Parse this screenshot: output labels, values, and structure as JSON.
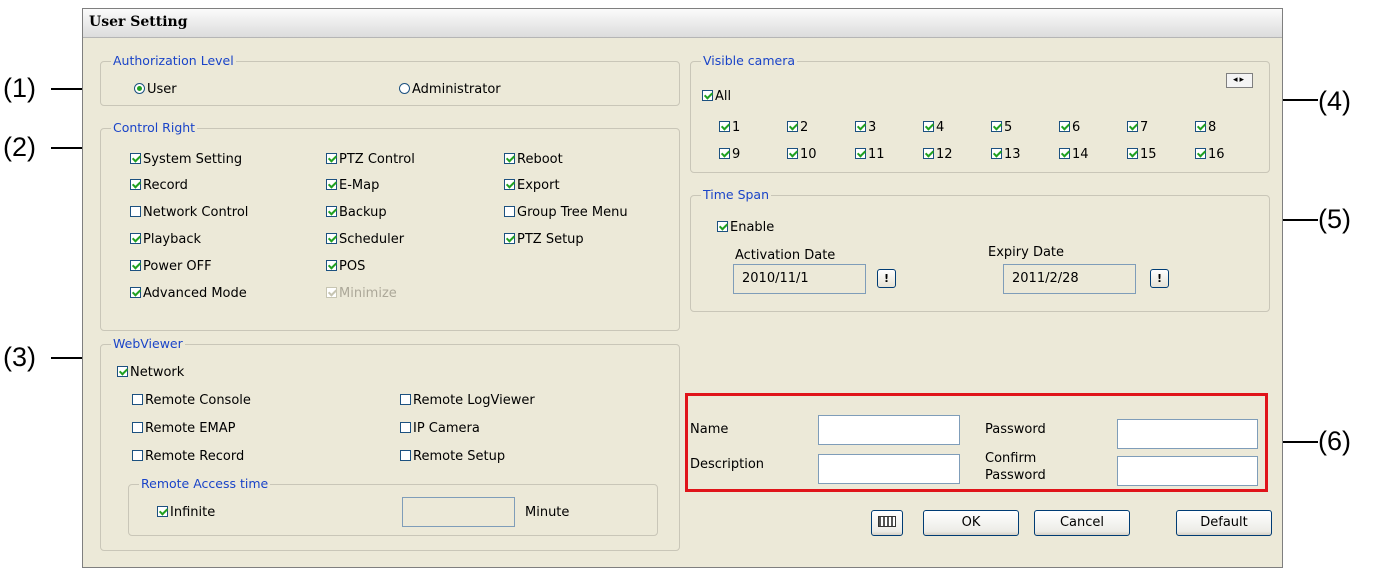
{
  "window": {
    "title": "User Setting"
  },
  "callouts": [
    "(1)",
    "(2)",
    "(3)",
    "(4)",
    "(5)",
    "(6)"
  ],
  "authorization": {
    "legend": "Authorization Level",
    "options": [
      {
        "label": "User",
        "selected": true
      },
      {
        "label": "Administrator",
        "selected": false
      }
    ]
  },
  "control_right": {
    "legend": "Control Right",
    "items": [
      {
        "label": "System Setting",
        "checked": true
      },
      {
        "label": "PTZ Control",
        "checked": true
      },
      {
        "label": "Reboot",
        "checked": true
      },
      {
        "label": "Record",
        "checked": true
      },
      {
        "label": "E-Map",
        "checked": true
      },
      {
        "label": "Export",
        "checked": true
      },
      {
        "label": "Network Control",
        "checked": false
      },
      {
        "label": "Backup",
        "checked": true
      },
      {
        "label": "Group Tree Menu",
        "checked": false
      },
      {
        "label": "Playback",
        "checked": true
      },
      {
        "label": "Scheduler",
        "checked": true
      },
      {
        "label": "PTZ Setup",
        "checked": true
      },
      {
        "label": "Power OFF",
        "checked": true
      },
      {
        "label": "POS",
        "checked": true
      },
      {
        "label": "Advanced Mode",
        "checked": true
      },
      {
        "label": "Minimize",
        "checked": true,
        "disabled": true
      }
    ]
  },
  "webviewer": {
    "legend": "WebViewer",
    "network": {
      "label": "Network",
      "checked": true
    },
    "items": [
      {
        "label": "Remote Console",
        "checked": false
      },
      {
        "label": "Remote LogViewer",
        "checked": false
      },
      {
        "label": "Remote EMAP",
        "checked": false
      },
      {
        "label": "IP Camera",
        "checked": false
      },
      {
        "label": "Remote Record",
        "checked": false
      },
      {
        "label": "Remote Setup",
        "checked": false
      }
    ],
    "access_time": {
      "legend": "Remote Access time",
      "infinite_label": "Infinite",
      "infinite_checked": true,
      "value": "",
      "unit": "Minute"
    }
  },
  "visible_camera": {
    "legend": "Visible camera",
    "all": {
      "label": "All",
      "checked": true
    },
    "cameras": [
      "1",
      "2",
      "3",
      "4",
      "5",
      "6",
      "7",
      "8",
      "9",
      "10",
      "11",
      "12",
      "13",
      "14",
      "15",
      "16"
    ],
    "scroll_icons": [
      "arrow-left-icon",
      "arrow-right-icon"
    ]
  },
  "time_span": {
    "legend": "Time Span",
    "enable": {
      "label": "Enable",
      "checked": true
    },
    "activation_label": "Activation Date",
    "activation_value": "2010/11/1",
    "expiry_label": "Expiry Date",
    "expiry_value": "2011/2/28",
    "calendar_button": "!"
  },
  "account": {
    "name_label": "Name",
    "name_value": "",
    "password_label": "Password",
    "password_value": "",
    "description_label": "Description",
    "description_value": "",
    "confirm_label": "Confirm\nPassword",
    "confirm_value": ""
  },
  "buttons": {
    "keyboard_icon": "keyboard-icon",
    "ok": "OK",
    "cancel": "Cancel",
    "default": "Default"
  },
  "colors": {
    "highlight_box": "#e0141a",
    "group_legend": "#1a44c8",
    "check_mark": "#21a121"
  }
}
